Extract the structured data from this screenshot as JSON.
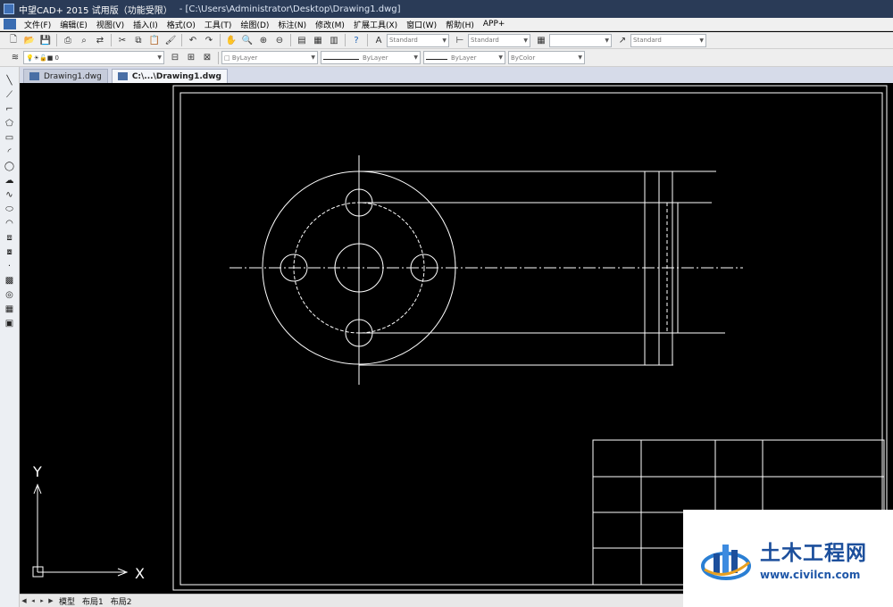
{
  "titlebar": {
    "app_title": "中望CAD+ 2015 试用版（功能受限）",
    "file_path": "- [C:\\Users\\Administrator\\Desktop\\Drawing1.dwg]"
  },
  "menu": {
    "items": [
      "文件(F)",
      "编辑(E)",
      "视图(V)",
      "插入(I)",
      "格式(O)",
      "工具(T)",
      "绘图(D)",
      "标注(N)",
      "修改(M)",
      "扩展工具(X)",
      "窗口(W)",
      "帮助(H)",
      "APP+"
    ]
  },
  "toolbar": {
    "text_style": "Standard",
    "dim_style": "Standard",
    "table_style": "",
    "multileader_style": "Standard",
    "layer": "0",
    "color": "ByLayer",
    "linetype": "ByLayer",
    "lineweight": "ByLayer",
    "plotstyle": "ByColor"
  },
  "tabs": {
    "doc1": "Drawing1.dwg",
    "doc2": "C:\\...\\Drawing1.dwg"
  },
  "layout_tabs": [
    "模型",
    "布局1",
    "布局2"
  ],
  "ucs": {
    "x_label": "X",
    "y_label": "Y"
  },
  "watermark": {
    "title": "土木工程网",
    "url": "www.civilcn.com"
  },
  "icons": {
    "left_tools": [
      "line-icon",
      "xline-icon",
      "polyline-icon",
      "polygon-icon",
      "rectangle-icon",
      "arc-icon",
      "circle-icon",
      "cloud-icon",
      "spline-icon",
      "ellipse-icon",
      "ellipse-arc-icon",
      "insert-block-icon",
      "make-block-icon",
      "point-icon",
      "hatch-icon",
      "region-icon",
      "table-icon",
      "image-icon"
    ]
  },
  "colors": {
    "canvas": "#000000",
    "geometry": "#ffffff",
    "titlebar": "#2a3b57"
  }
}
